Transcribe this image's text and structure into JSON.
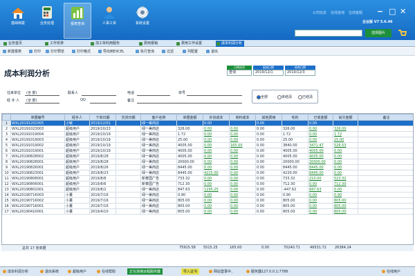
{
  "nav": [
    {
      "label": "基础档案",
      "icon": "house-icon"
    },
    {
      "label": "业务处理",
      "icon": "calculator-icon"
    },
    {
      "label": "报表查询",
      "icon": "chart-icon"
    },
    {
      "label": "人事工资",
      "icon": "people-icon"
    },
    {
      "label": "系统设置",
      "icon": "gear-icon"
    }
  ],
  "top_links": [
    "公司信息",
    "在线咨询",
    "在线客服"
  ],
  "window_buttons": [
    "−",
    "□",
    "✕"
  ],
  "version": "企业版 V7 5.6.46",
  "search_button": "选择图片",
  "tabs": [
    "业务首页",
    "工作安排",
    "加工单利用服务",
    "费用报销",
    "费用工作设置",
    "成本利润分析"
  ],
  "toolbar": [
    "新建报表",
    "打印",
    "打印预览",
    "打印格式",
    "导出到EXCEL",
    "执行查询",
    "过滤",
    "列配置",
    "退出"
  ],
  "page_title": "成本利润分析",
  "date_boxes": [
    {
      "header": "日期选项",
      "value": "查询"
    },
    {
      "header": "起始日期",
      "value": "2019/12/1"
    },
    {
      "header": "结束日期",
      "value": "2019/12/3"
    }
  ],
  "filters": {
    "unit_label": "往来单位",
    "unit_value": "(全 部)",
    "contact_label": "联系人",
    "phone_label": "电话",
    "number_label": "单号",
    "operator_label": "经 手 人",
    "operator_value": "(全 部)",
    "ship_label": "QQ",
    "remark_label": "备注"
  },
  "radios": [
    {
      "label": "全部",
      "on": true
    },
    {
      "label": "未结清",
      "on": false
    },
    {
      "label": "已结清",
      "on": false
    }
  ],
  "columns": [
    "",
    "单据编号",
    "经手人",
    "下单日期",
    "交货日期",
    "客户名称",
    "单据金额",
    "外协成本",
    "商料成本",
    "其他费用",
    "毛利",
    "已收金额",
    "尚欠金额",
    "备注"
  ],
  "rows": [
    [
      "1",
      "WXL20191202005",
      "小敏",
      "2019/12/01",
      "",
      "绿一美商店",
      "",
      "0.00",
      "",
      "0.00",
      "",
      "0.00",
      "",
      ""
    ],
    [
      "2",
      "WXL20191023003",
      "超级用户",
      "2019/10/23",
      "",
      "绿一美商店",
      "326.00",
      "0.00",
      "0.00",
      "0.00",
      "326.00",
      "0.00",
      "326.00",
      ""
    ],
    [
      "3",
      "WXL20191019004",
      "超级用户",
      "2019/10/19",
      "",
      "绿一美商店",
      "1.72",
      "0.00",
      "0.00",
      "0.00",
      "1.72",
      "0.00",
      "1.72",
      ""
    ],
    [
      "4",
      "WXL20191019003",
      "超级用户",
      "2019/10/19",
      "",
      "绿一美商店",
      "25.00",
      "0.00",
      "0.00",
      "0.00",
      "25.00",
      "0.00",
      "25.00",
      ""
    ],
    [
      "5",
      "WXL20191019002",
      "超级用户",
      "2019/10/19",
      "",
      "绿一美商店",
      "4005.00",
      "0.00",
      "165.00",
      "0.00",
      "3840.00",
      "3471.47",
      "526.53",
      ""
    ],
    [
      "6",
      "WXL20191019001",
      "超级用户",
      "2019/10/19",
      "",
      "绿一美商店",
      "4005.00",
      "0.00",
      "0.00",
      "0.00",
      "4005.00",
      "4005.00",
      "0.00",
      ""
    ],
    [
      "7",
      "WXL20190828002",
      "超级用户",
      "2019/8/28",
      "",
      "绿一美商店",
      "4005.00",
      "0.00",
      "0.00",
      "0.00",
      "4005.00",
      "4005.00",
      "0.00",
      ""
    ],
    [
      "8",
      "WXL20190828001",
      "超级用户",
      "2019/8/28",
      "",
      "绿一美商店",
      "20000.00",
      "0.00",
      "0.00",
      "0.00",
      "20000.00",
      "20000.00",
      "0.00",
      ""
    ],
    [
      "9",
      "WXL20190826001",
      "超级用户",
      "2019/8/26",
      "",
      "绿一美商店",
      "8445.00",
      "0.00",
      "0.00",
      "0.00",
      "8445.00",
      "8445.00",
      "0.00",
      ""
    ],
    [
      "10",
      "WXL20190823001",
      "超级用户",
      "2019/8/23",
      "",
      "绿一美商店",
      "8445.00",
      "4225.00",
      "0.00",
      "0.00",
      "4220.00",
      "8445.00",
      "0.00",
      ""
    ],
    [
      "11",
      "WXL20190808001",
      "超级用户",
      "2019/8/8",
      "",
      "新泰国广告",
      "733.32",
      "0.00",
      "0.00",
      "0.00",
      "733.32",
      "210.00",
      "523.32",
      ""
    ],
    [
      "12",
      "WXL20190806001",
      "超级用户",
      "2019/8/6",
      "",
      "新泰国广告",
      "712.30",
      "0.00",
      "0.00",
      "0.00",
      "712.30",
      "0.00",
      "712.30",
      ""
    ],
    [
      "13",
      "WXL20190802001",
      "超级用户",
      "2019/8/2",
      "",
      "绿一美商店",
      "847.63",
      "1295.25",
      "0.00",
      "0.00",
      "-447.62",
      "847.63",
      "0.00",
      ""
    ],
    [
      "14",
      "WXL20190716003",
      "小董",
      "2019/7/16",
      "",
      "绿一美商店",
      "0.90",
      "0.00",
      "0.00",
      "0.00",
      "0.90",
      "0.00",
      "0.90",
      ""
    ],
    [
      "15",
      "WXL20190716002",
      "小董",
      "2019/7/16",
      "",
      "绿一美商店",
      "805.00",
      "0.00",
      "0.00",
      "0.00",
      "805.00",
      "0.00",
      "805.00",
      ""
    ],
    [
      "16",
      "WXL20190716001",
      "小董",
      "2019/7/16",
      "",
      "绿一美商店",
      "805.00",
      "0.00",
      "0.00",
      "0.00",
      "805.00",
      "0.00",
      "805.00",
      ""
    ],
    [
      "17",
      "WXL20190410001",
      "小董",
      "2019/4/10",
      "",
      "绿一美商店",
      "805.00",
      "0.00",
      "0.00",
      "0.00",
      "805.00",
      "0.00",
      "805.00",
      ""
    ]
  ],
  "summary": {
    "label": "总共 17 张单据",
    "values": [
      "75915.58",
      "5515.25",
      "165.00",
      "0.00",
      "70240.71",
      "49531.72",
      "26384.24"
    ]
  },
  "status": [
    "成本利润分析",
    "退出系统",
    "超级用户",
    "在线帮助",
    "正在连接远程服务器",
    "导入证书",
    "网站登录中..",
    "服务器127.0.0.1:7788",
    "在线用户"
  ]
}
